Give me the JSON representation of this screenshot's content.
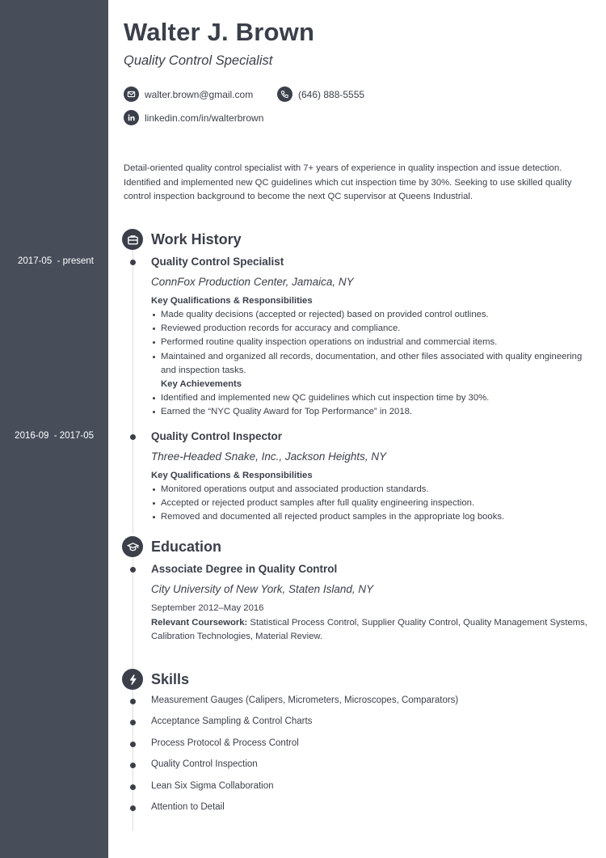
{
  "header": {
    "name": "Walter J. Brown",
    "title": "Quality Control Specialist",
    "contacts": {
      "email": {
        "icon": "envelope-icon",
        "value": "walter.brown@gmail.com"
      },
      "phone": {
        "icon": "phone-icon",
        "value": "(646) 888-5555"
      },
      "linkedin": {
        "icon": "linkedin-icon",
        "value": "linkedin.com/in/walterbrown"
      }
    }
  },
  "summary": "Detail-oriented quality control specialist with 7+ years of experience in quality inspection and issue detection. Identified and implemented new QC guidelines which cut inspection time by 30%. Seeking to use skilled quality control inspection background to become the next QC supervisor at Queens Industrial.",
  "work_history": {
    "heading": "Work History",
    "icon": "briefcase-icon",
    "jobs": [
      {
        "dates": "2017-05  - present",
        "title": "Quality Control Specialist",
        "company": "ConnFox Production Center, Jamaica, NY",
        "qual_heading": "Key Qualifications & Responsibilities",
        "responsibilities": [
          "Made quality decisions (accepted or rejected) based on provided control outlines.",
          "Reviewed production records for accuracy and compliance.",
          "Performed routine quality inspection operations on industrial and commercial items.",
          "Maintained and organized all records, documentation, and other files associated with quality engineering and inspection tasks."
        ],
        "achievements_heading": "Key Achievements",
        "achievements": [
          "Identified and implemented new QC guidelines which cut inspection time by 30%.",
          "Earned the “NYC Quality Award for Top Performance” in 2018."
        ]
      },
      {
        "dates": "2016-09  - 2017-05",
        "title": "Quality Control Inspector",
        "company": "Three-Headed Snake, Inc., Jackson Heights, NY",
        "qual_heading": "Key Qualifications & Responsibilities",
        "responsibilities": [
          "Monitored operations output and associated production standards.",
          "Accepted or rejected product samples after full quality engineering inspection.",
          "Removed and documented all rejected product samples in the appropriate log books."
        ]
      }
    ]
  },
  "education": {
    "heading": "Education",
    "icon": "graduation-cap-icon",
    "degree": "Associate Degree in Quality Control",
    "school": "City University of New York, Staten Island, NY",
    "dates": "September 2012–May 2016",
    "coursework_label": "Relevant Coursework:",
    "coursework": " Statistical Process Control, Supplier Quality Control, Quality Management Systems, Calibration Technologies, Material Review."
  },
  "skills": {
    "heading": "Skills",
    "icon": "lightning-bolt-icon",
    "items": [
      "Measurement Gauges (Calipers, Micrometers, Microscopes, Comparators)",
      "Acceptance Sampling & Control Charts",
      "Process Protocol & Process Control",
      "Quality Control Inspection",
      "Lean Six Sigma Collaboration",
      "Attention to Detail"
    ]
  },
  "colors": {
    "sidebar": "#474e5a",
    "text": "#3a3f4a",
    "timeline": "#dcdde0"
  }
}
